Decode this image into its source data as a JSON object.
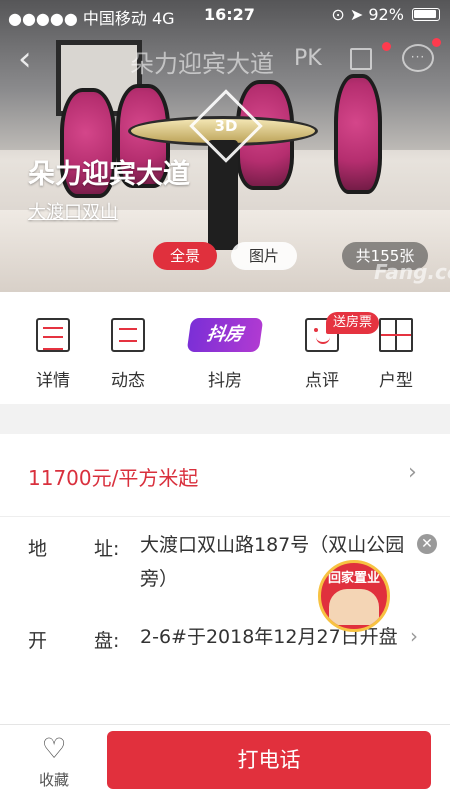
{
  "status_bar": {
    "carrier": "●●●●● 中国移动  4G",
    "time": "16:27",
    "battery": "92%"
  },
  "navbar": {
    "title": "朵力迎宾大道",
    "pk_label": "PK",
    "message_icon_text": "···"
  },
  "hero": {
    "title": "朵力迎宾大道",
    "area": "大渡口双山",
    "badge_3d": "3D",
    "tabs": [
      "全景",
      "图片"
    ],
    "count": "共155张",
    "watermark": "Fang.com"
  },
  "quick_nav": [
    {
      "label": "详情",
      "icon": "details-icon"
    },
    {
      "label": "动态",
      "icon": "news-icon"
    },
    {
      "label": "抖房",
      "icon": "doufang-logo"
    },
    {
      "label": "点评",
      "icon": "review-icon",
      "badge": "送房票"
    },
    {
      "label": "户型",
      "icon": "floorplan-icon"
    }
  ],
  "doufang_text": "抖房",
  "info": {
    "price": "11700元/平方米起",
    "address_label": [
      "地",
      "址:"
    ],
    "address_value": "大渡口双山路187号（双山公园旁）",
    "opening_label": [
      "开",
      "盘:"
    ],
    "opening_value": "2-6#于2018年12月27日开盘"
  },
  "ad_badge": {
    "text": "回家置业"
  },
  "bottom_bar": {
    "favorite_label": "收藏",
    "call_label": "打电话"
  },
  "colors": {
    "accent": "#e1303d",
    "price": "#d9303d"
  }
}
